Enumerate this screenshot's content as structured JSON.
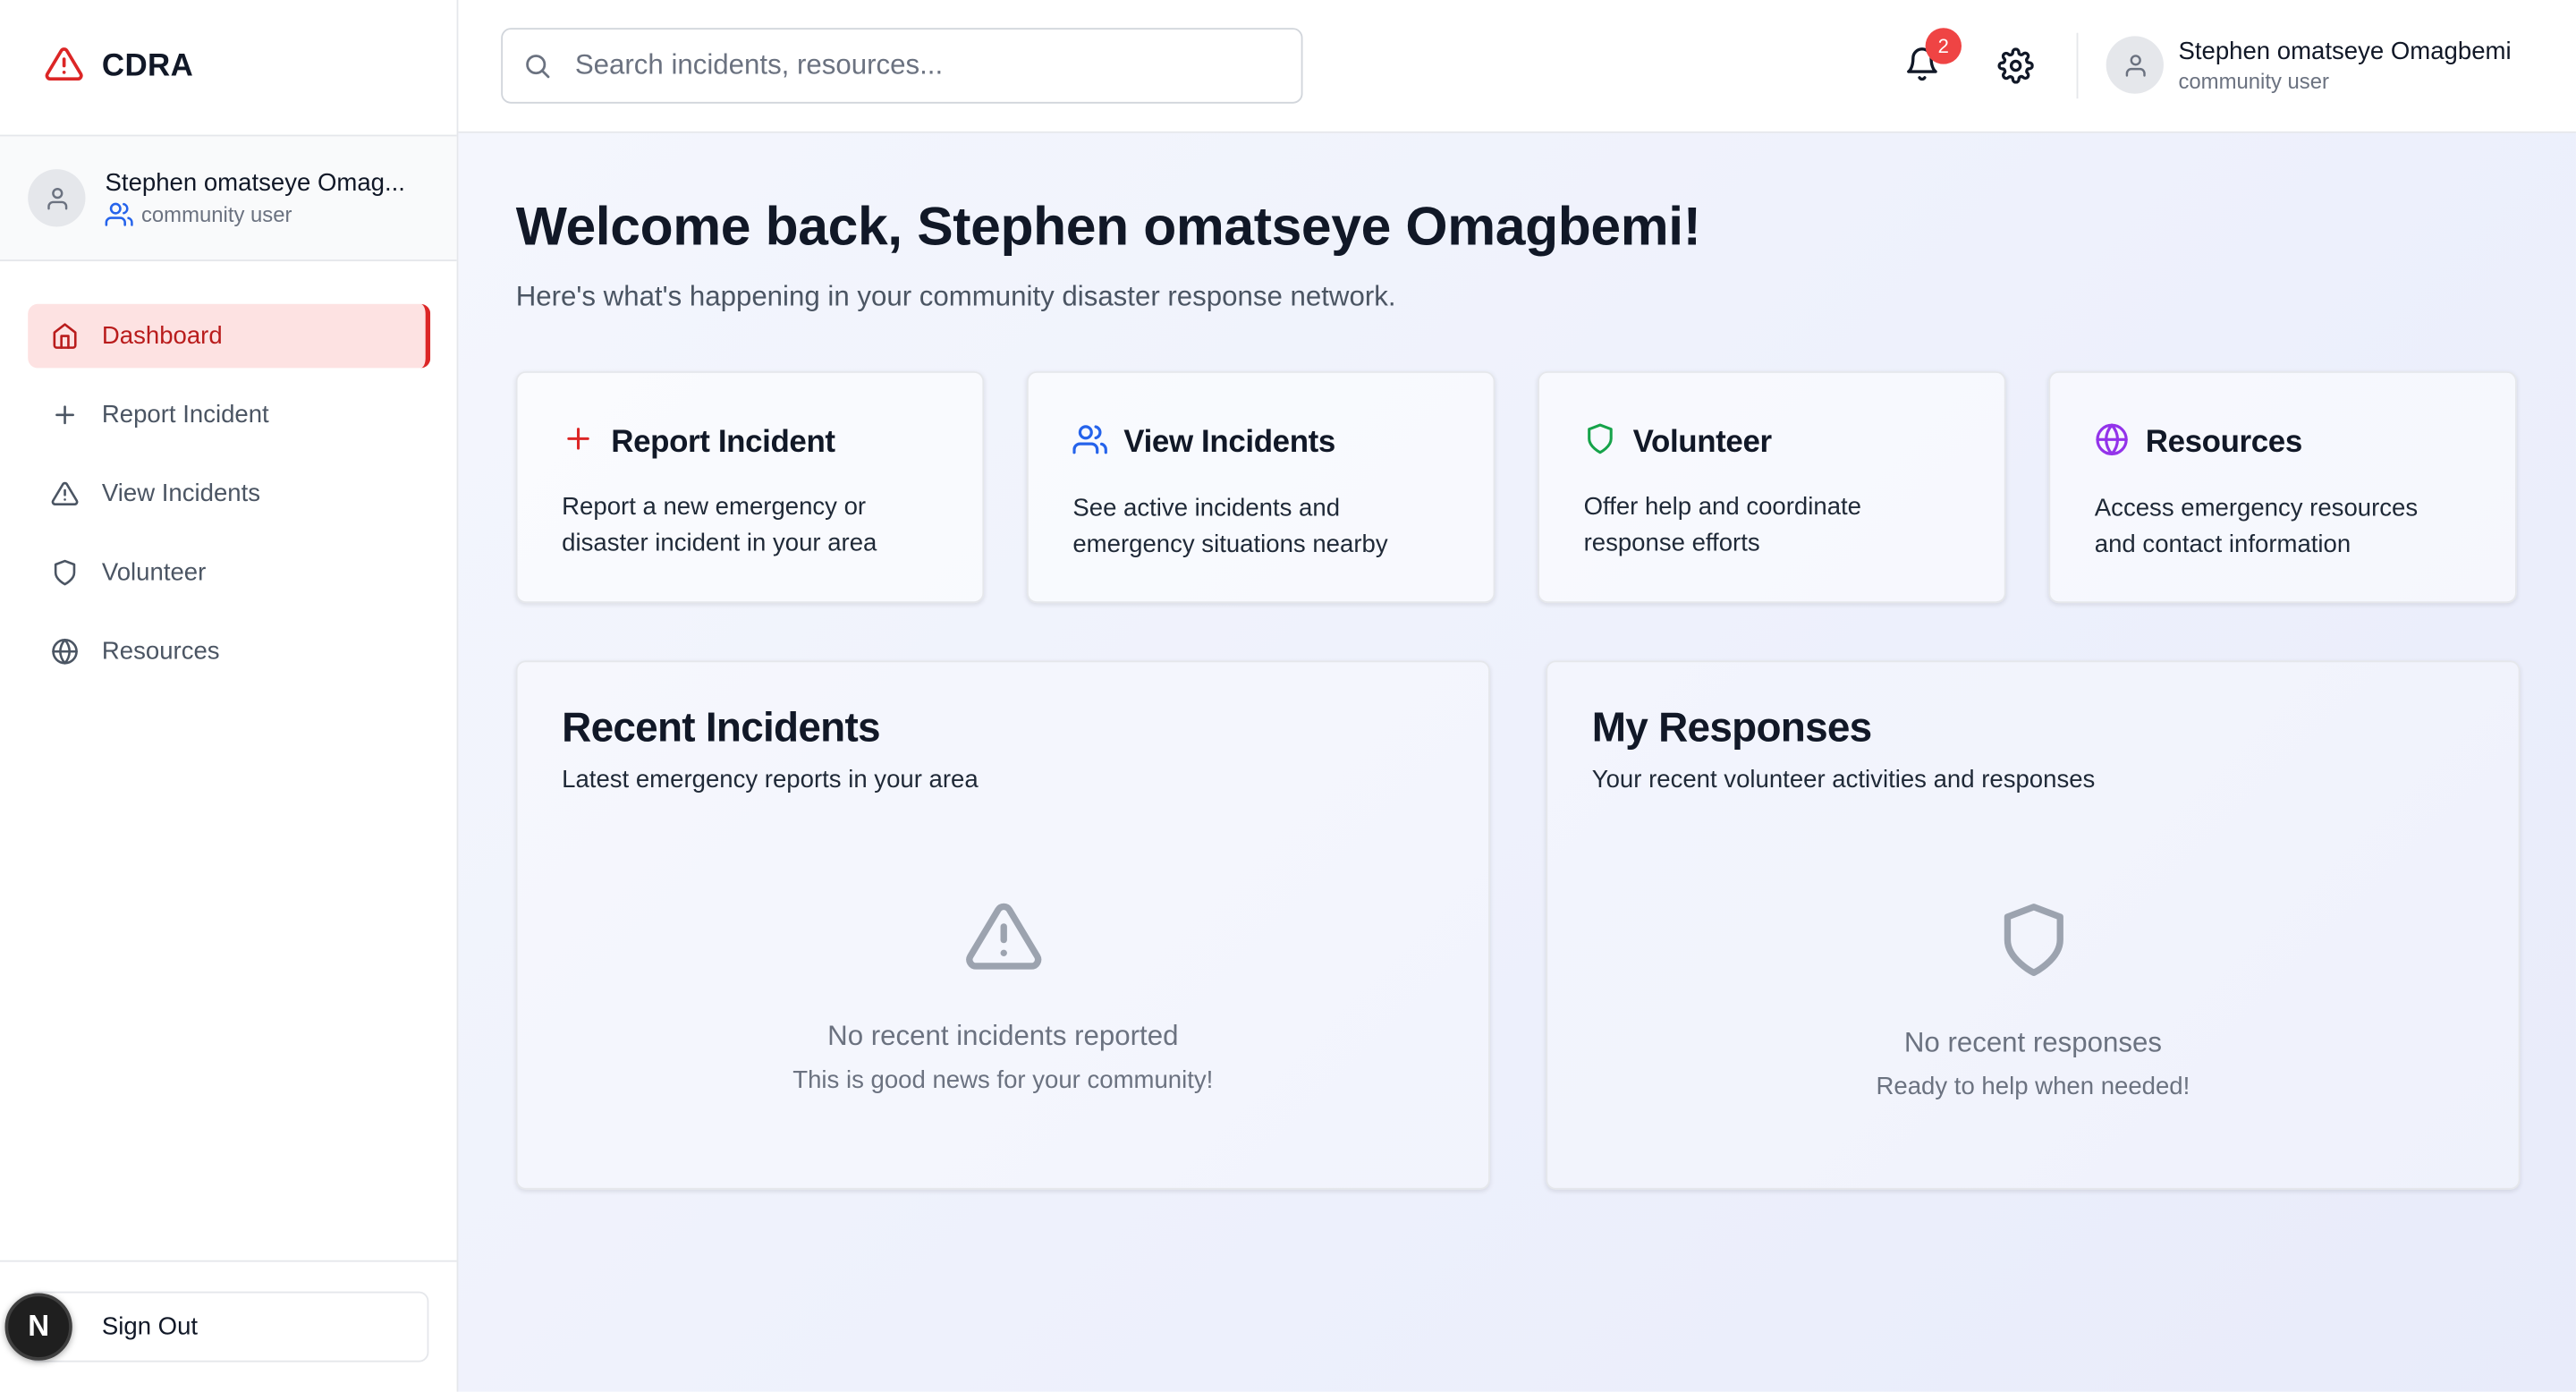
{
  "brand": {
    "name": "CDRA",
    "accent": "#dc2626"
  },
  "sidebar": {
    "user": {
      "name": "Stephen omatseye Omag...",
      "role": "community user"
    },
    "items": [
      {
        "label": "Dashboard",
        "icon": "home-icon",
        "active": true
      },
      {
        "label": "Report Incident",
        "icon": "plus-icon",
        "active": false
      },
      {
        "label": "View Incidents",
        "icon": "warning-triangle-icon",
        "active": false
      },
      {
        "label": "Volunteer",
        "icon": "shield-icon",
        "active": false
      },
      {
        "label": "Resources",
        "icon": "globe-icon",
        "active": false
      }
    ],
    "sign_out": "Sign Out",
    "dev_badge": "N"
  },
  "header": {
    "search_placeholder": "Search incidents, resources...",
    "notification_count": "2",
    "user": {
      "name": "Stephen omatseye Omagbemi",
      "role": "community user"
    }
  },
  "main": {
    "welcome": "Welcome back, Stephen omatseye Omagbemi!",
    "subtitle": "Here's what's happening in your community disaster response network.",
    "cards": [
      {
        "title": "Report Incident",
        "desc": "Report a new emergency or disaster incident in your area",
        "icon": "plus-icon",
        "color": "#dc2626"
      },
      {
        "title": "View Incidents",
        "desc": "See active incidents and emergency situations nearby",
        "icon": "users-icon",
        "color": "#2563eb"
      },
      {
        "title": "Volunteer",
        "desc": "Offer help and coordinate response efforts",
        "icon": "shield-icon",
        "color": "#16a34a"
      },
      {
        "title": "Resources",
        "desc": "Access emergency resources and contact information",
        "icon": "globe-icon",
        "color": "#9333ea"
      }
    ],
    "panels": [
      {
        "title": "Recent Incidents",
        "subtitle": "Latest emergency reports in your area",
        "empty_title": "No recent incidents reported",
        "empty_sub": "This is good news for your community!",
        "icon": "warning-triangle-icon"
      },
      {
        "title": "My Responses",
        "subtitle": "Your recent volunteer activities and responses",
        "empty_title": "No recent responses",
        "empty_sub": "Ready to help when needed!",
        "icon": "shield-icon"
      }
    ]
  }
}
